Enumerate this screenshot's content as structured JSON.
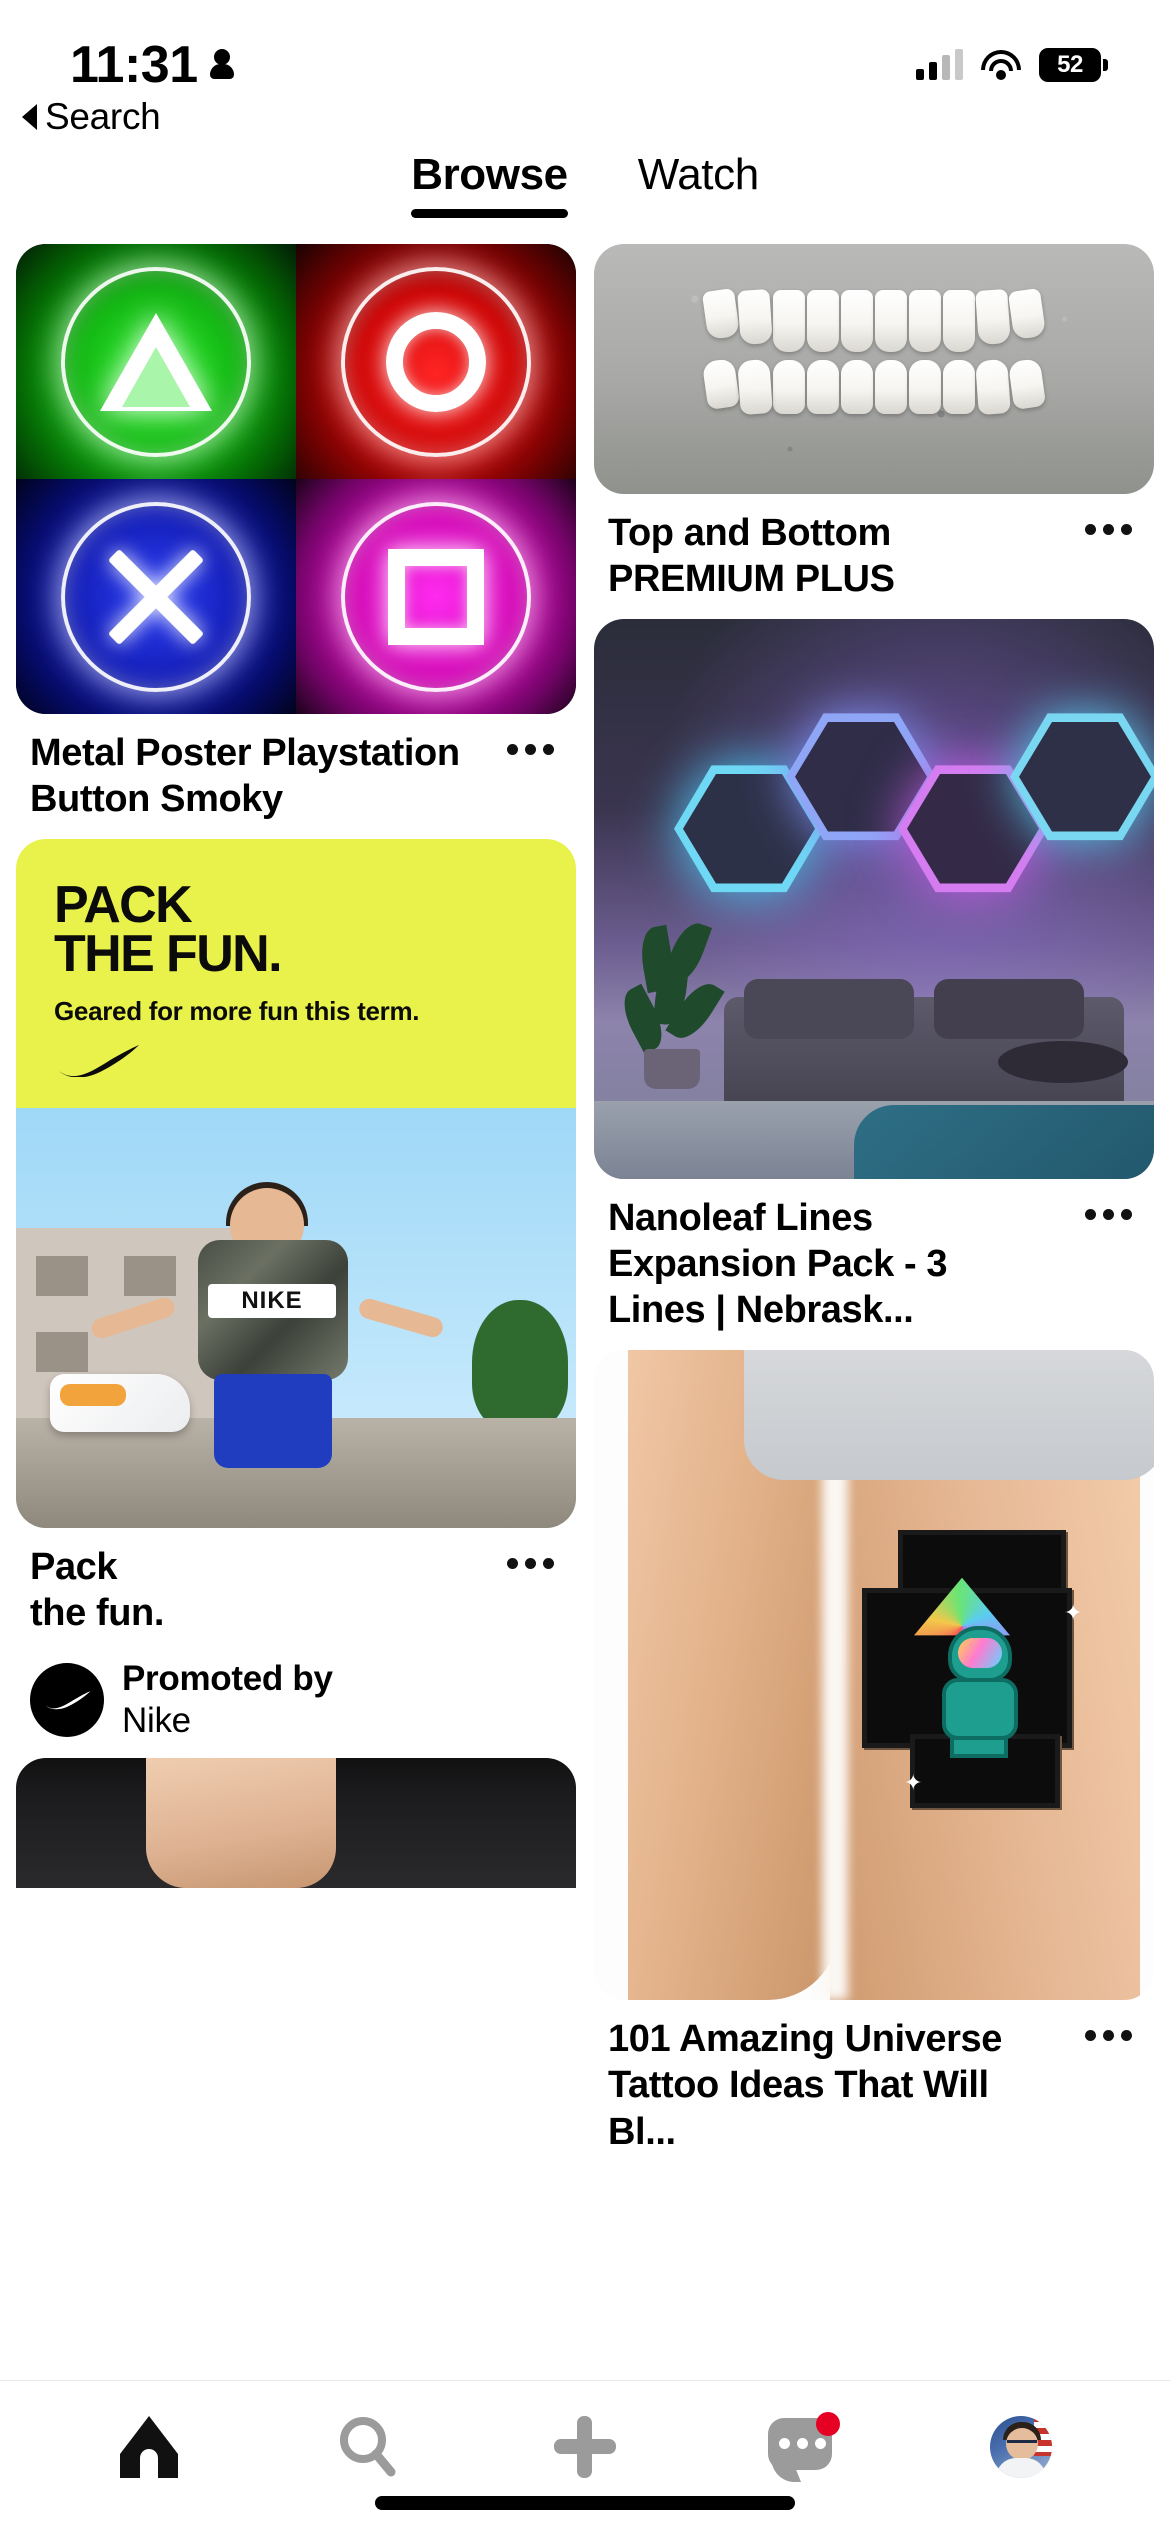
{
  "status_bar": {
    "time": "11:31",
    "person_icon": "person-icon",
    "cellular_icon": "cellular-bars-icon",
    "wifi_icon": "wifi-icon",
    "battery_percent": "52"
  },
  "back_link": {
    "caret_icon": "back-caret-icon",
    "label": "Search"
  },
  "tabs": [
    {
      "label": "Browse",
      "active": true
    },
    {
      "label": "Watch",
      "active": false
    }
  ],
  "feed": {
    "left_column": [
      {
        "id": "pin-playstation",
        "title": "Metal Poster Playstation Button Smoky",
        "overflow_icon": "more-options-icon",
        "image": "neon-playstation-buttons"
      },
      {
        "id": "pin-nike-promoted",
        "title": "Pack\nthe fun.",
        "title_line1": "Pack",
        "title_line2": "the fun.",
        "overflow_icon": "more-options-icon",
        "image": "nike-pack-the-fun-ad",
        "ad_copy": {
          "line1": "PACK",
          "line2": "THE FUN.",
          "subline": "Geared for more fun this term.",
          "logo_icon": "nike-swoosh-icon",
          "background_color": "#e9f24a"
        },
        "promoter": {
          "label": "Promoted by",
          "brand": "Nike",
          "avatar_icon": "nike-swoosh-avatar"
        }
      },
      {
        "id": "pin-partial-bottom",
        "title": "",
        "image": "partial-pin-cut-off"
      }
    ],
    "right_column": [
      {
        "id": "pin-veneers",
        "title": "Top and Bottom PREMIUM PLUS",
        "overflow_icon": "more-options-icon",
        "image": "dental-veneers-on-concrete"
      },
      {
        "id": "pin-nanoleaf",
        "title": "Nanoleaf Lines Expansion Pack - 3 Lines | Nebrask...",
        "overflow_icon": "more-options-icon",
        "image": "nanoleaf-hexagon-lights-room"
      },
      {
        "id": "pin-tattoo",
        "title": "101 Amazing Universe Tattoo Ideas That Will Bl...",
        "overflow_icon": "more-options-icon",
        "image": "astronaut-thigh-tattoo"
      }
    ]
  },
  "bottom_nav": [
    {
      "id": "home",
      "icon": "home-icon",
      "active": true,
      "badge": false
    },
    {
      "id": "search",
      "icon": "search-icon",
      "active": false,
      "badge": false
    },
    {
      "id": "create",
      "icon": "plus-icon",
      "active": false,
      "badge": false
    },
    {
      "id": "messages",
      "icon": "chat-bubble-icon",
      "active": false,
      "badge": true
    },
    {
      "id": "profile",
      "icon": "profile-avatar",
      "active": false,
      "badge": false
    }
  ],
  "colors": {
    "accent_red": "#e60023",
    "nike_yellow": "#e9f24a",
    "active_black": "#000000",
    "inactive_gray": "#9b9b9b"
  }
}
